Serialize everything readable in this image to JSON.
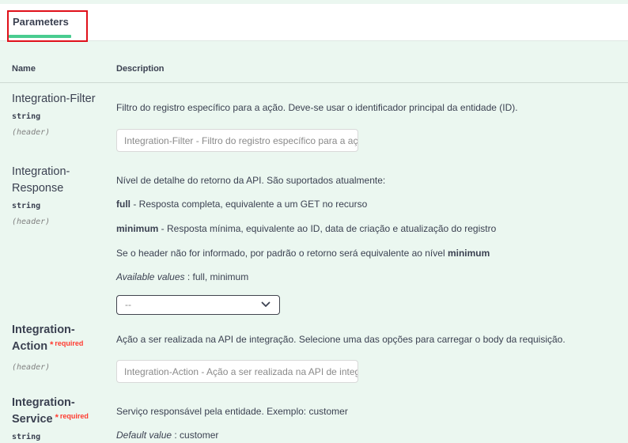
{
  "tabs": {
    "active_label": "Parameters"
  },
  "table": {
    "col_name": "Name",
    "col_description": "Description"
  },
  "params": [
    {
      "name": "Integration-Filter",
      "type": "string",
      "in": "(header)",
      "description": "Filtro do registro específico para a ação. Deve-se usar o identificador principal da entidade (ID).",
      "placeholder": "Integration-Filter - Filtro do registro específico para a ação. Deve-se usar o identificador principal da entidade (ID)."
    },
    {
      "name_line1": "Integration-",
      "name_line2": "Response",
      "type": "string",
      "in": "(header)",
      "desc_intro": "Nível de detalhe do retorno da API. São suportados atualmente:",
      "opt1_key": "full",
      "opt1_text": " - Resposta completa, equivalente a um GET no recurso",
      "opt2_key": "minimum",
      "opt2_text": " - Resposta mínima, equivalente ao ID, data de criação e atualização do registro",
      "default_text": "Se o header não for informado, por padrão o retorno será equivalente ao nível ",
      "default_key": "minimum",
      "available_label": "Available values",
      "available_values": " : full, minimum",
      "select_value": "--"
    },
    {
      "name_line1": "Integration-",
      "name_line2": "Action",
      "required_mark": "*",
      "required_label": "required",
      "in": "(header)",
      "description": "Ação a ser realizada na API de integração. Selecione uma das opções para carregar o body da requisição.",
      "placeholder": "Integration-Action - Ação a ser realizada na API de integração"
    },
    {
      "name_line1": "Integration-",
      "name_line2": "Service",
      "required_mark": "*",
      "required_label": "required",
      "type": "string",
      "description": "Serviço responsável pela entidade. Exemplo: customer",
      "default_label": "Default value",
      "default_value": " : customer"
    }
  ]
}
